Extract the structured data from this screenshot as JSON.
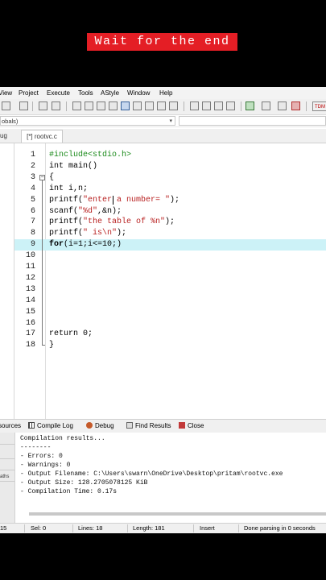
{
  "banner": {
    "text": "Wait for the end"
  },
  "menu": [
    "View",
    "Project",
    "Execute",
    "Tools",
    "AStyle",
    "Window",
    "Help"
  ],
  "toolbar": {
    "right_label": "TDM"
  },
  "scope_selector": {
    "value": "obals)"
  },
  "tabs": {
    "left_fragment": "ug",
    "file_tab": "[*] rootvc.c"
  },
  "editor": {
    "lines": [
      {
        "n": "1",
        "parts": [
          {
            "t": "#include<stdio.h>",
            "c": "pp"
          }
        ]
      },
      {
        "n": "2",
        "parts": [
          {
            "t": "int main()",
            "c": ""
          }
        ]
      },
      {
        "n": "3",
        "parts": [
          {
            "t": "{",
            "c": ""
          }
        ]
      },
      {
        "n": "4",
        "parts": [
          {
            "t": "int i,n;",
            "c": ""
          }
        ]
      },
      {
        "n": "5",
        "parts": [
          {
            "t": "printf(",
            "c": ""
          },
          {
            "t": "\"enter a number= \"",
            "c": "st"
          },
          {
            "t": ");",
            "c": ""
          }
        ]
      },
      {
        "n": "6",
        "parts": [
          {
            "t": "scanf(",
            "c": ""
          },
          {
            "t": "\"%d\"",
            "c": "st"
          },
          {
            "t": ",&n);",
            "c": ""
          }
        ]
      },
      {
        "n": "7",
        "parts": [
          {
            "t": "printf(",
            "c": ""
          },
          {
            "t": "\"the table of %n\"",
            "c": "st"
          },
          {
            "t": ");",
            "c": ""
          }
        ]
      },
      {
        "n": "8",
        "parts": [
          {
            "t": "printf(",
            "c": ""
          },
          {
            "t": "\" is\\n\"",
            "c": "st"
          },
          {
            "t": ");",
            "c": ""
          }
        ]
      },
      {
        "n": "9",
        "parts": [
          {
            "t": "for",
            "c": "bold"
          },
          {
            "t": "(i=1;i<=10;)",
            "c": ""
          }
        ]
      },
      {
        "n": "10",
        "parts": []
      },
      {
        "n": "11",
        "parts": []
      },
      {
        "n": "12",
        "parts": []
      },
      {
        "n": "13",
        "parts": []
      },
      {
        "n": "14",
        "parts": []
      },
      {
        "n": "15",
        "parts": []
      },
      {
        "n": "16",
        "parts": []
      },
      {
        "n": "17",
        "parts": [
          {
            "t": "return 0;",
            "c": ""
          }
        ]
      },
      {
        "n": "18",
        "parts": [
          {
            "t": "}",
            "c": ""
          }
        ]
      }
    ],
    "highlight_line": "9"
  },
  "bottom_tabs": [
    "sources",
    "Compile Log",
    "Debug",
    "Find Results",
    "Close"
  ],
  "log": {
    "left_items": [
      "",
      "",
      "",
      "aths"
    ],
    "lines": [
      "Compilation results...",
      "--------",
      "- Errors: 0",
      "- Warnings: 0",
      "- Output Filename: C:\\Users\\swarn\\OneDrive\\Desktop\\pritam\\rootvc.exe",
      "- Output Size: 128.2705078125 KiB",
      "- Compilation Time: 0.17s"
    ]
  },
  "status": {
    "col_fragment": "15",
    "sel": "Sel:   0",
    "lines": "Lines:   18",
    "length": "Length:   181",
    "mode": "Insert",
    "message": "Done parsing in 0 seconds"
  }
}
